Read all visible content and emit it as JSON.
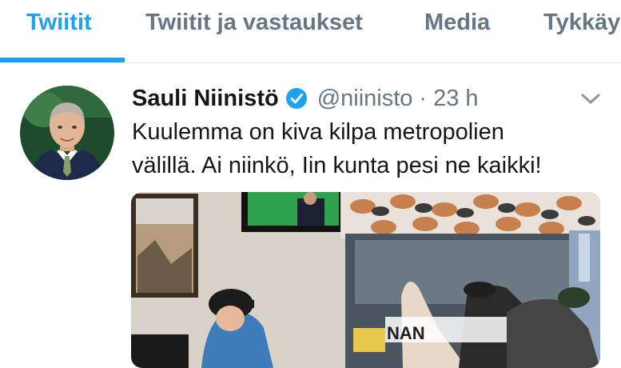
{
  "tabs": [
    {
      "label": "Twiitit",
      "active": true
    },
    {
      "label": "Twiitit ja vastaukset",
      "active": false
    },
    {
      "label": "Media",
      "active": false
    },
    {
      "label": "Tykkäy",
      "active": false
    }
  ],
  "tweet": {
    "author_name": "Sauli Niinistö",
    "handle": "@niinisto",
    "separator": "·",
    "time": "23 h",
    "verified": true,
    "text_line1": "Kuulemma on kiva kilpa metropolien",
    "text_line2": "välillä. Ai niinkö, Iin kunta pesi ne kaikki!",
    "media_sign_text": "NAN"
  },
  "icons": {
    "verified": "verified-badge-icon",
    "menu": "chevron-down-icon"
  },
  "colors": {
    "accent": "#1da1f2",
    "text_primary": "#14171a",
    "text_secondary": "#657786",
    "divider": "#e1e8ed"
  }
}
